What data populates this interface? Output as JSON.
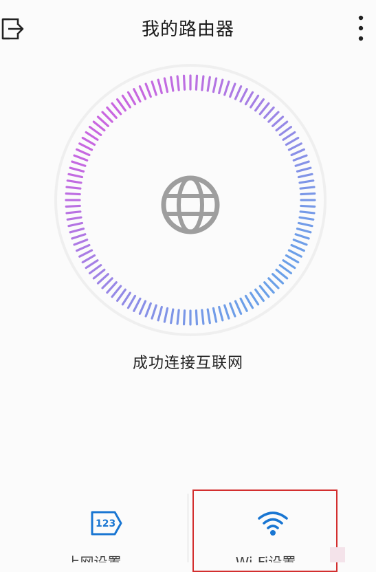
{
  "header": {
    "title": "我的路由器",
    "back_icon": "exit-icon",
    "more_icon": "more-vertical-icon"
  },
  "dial": {
    "center_icon": "globe-icon",
    "gradient_colors": [
      "#c966e0",
      "#9b86e6",
      "#6aa0e8"
    ],
    "ring_color": "#efefef"
  },
  "status": {
    "text": "成功连接互联网"
  },
  "bottom_nav": {
    "items": [
      {
        "label": "上网设置",
        "icon": "internet-setup-123-icon"
      },
      {
        "label": "Wi-Fi设置",
        "icon": "wifi-icon"
      }
    ]
  },
  "colors": {
    "accent": "#1976d2",
    "highlight": "#d32f2f"
  }
}
